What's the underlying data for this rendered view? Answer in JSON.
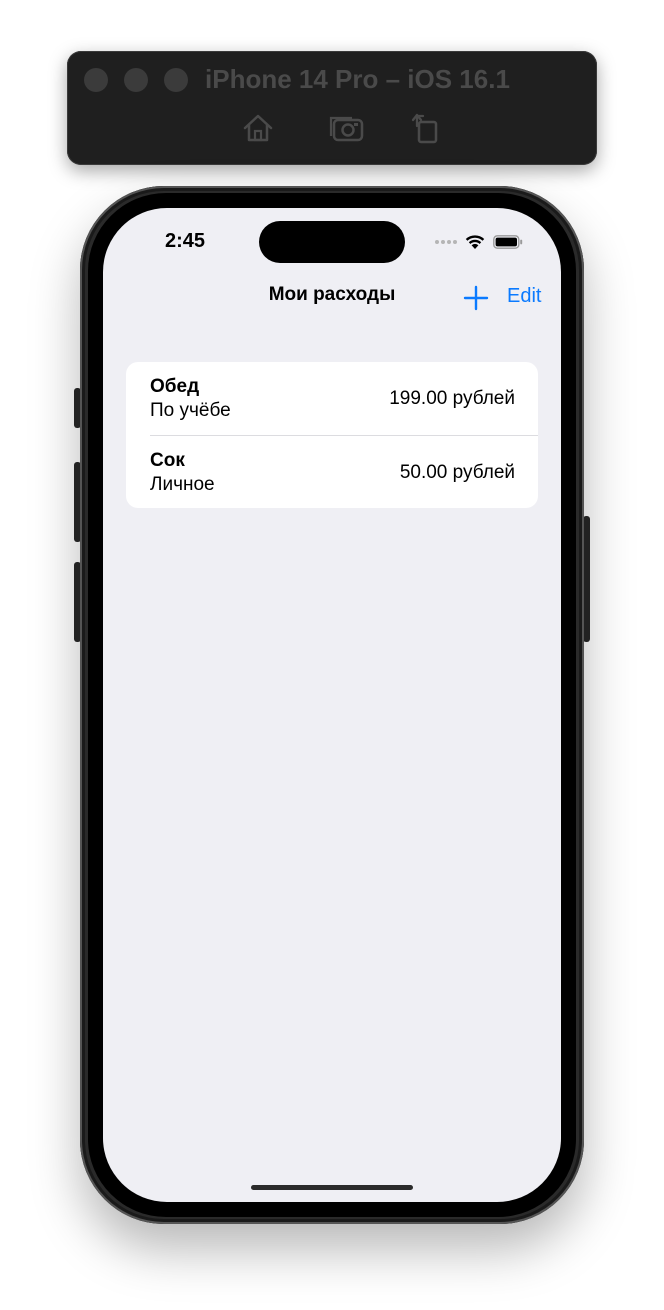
{
  "simulator": {
    "title": "iPhone 14 Pro – iOS 16.1",
    "buttons": [
      "home-icon",
      "screenshot-icon",
      "rotate-icon"
    ]
  },
  "status_bar": {
    "time": "2:45"
  },
  "nav_bar": {
    "title": "Мои расходы",
    "add_icon": "plus-icon",
    "edit_label": "Edit"
  },
  "expenses": [
    {
      "name": "Обед",
      "category": "По учёбе",
      "amount": "199.00 рублей"
    },
    {
      "name": "Сок",
      "category": "Личное",
      "amount": "50.00 рублей"
    }
  ],
  "colors": {
    "accent": "#0a7aff",
    "background": "#efeff4",
    "card": "#ffffff"
  }
}
